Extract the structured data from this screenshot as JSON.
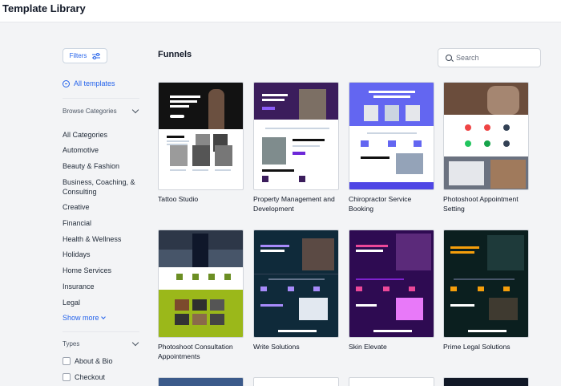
{
  "app": {
    "title": "Template Library"
  },
  "sidebar": {
    "filters_label": "Filters",
    "all_templates_label": "All templates",
    "browse_categories_label": "Browse Categories",
    "categories": [
      "All Categories",
      "Automotive",
      "Beauty & Fashion",
      "Business, Coaching, & Consulting",
      "Creative",
      "Financial",
      "Health & Wellness",
      "Holidays",
      "Home Services",
      "Insurance",
      "Legal"
    ],
    "show_more_label": "Show more",
    "types_label": "Types",
    "types": [
      "About & Bio",
      "Checkout"
    ]
  },
  "main": {
    "title": "Funnels",
    "search": {
      "placeholder": "Search"
    },
    "templates": [
      {
        "name": "Tattoo Studio",
        "color": "#111111"
      },
      {
        "name": "Property Management and Development",
        "color": "#3b1d5c"
      },
      {
        "name": "Chiropractor Service Booking",
        "color": "#6366f1"
      },
      {
        "name": "Photoshoot Appointment Setting",
        "color": "#1f2937"
      },
      {
        "name": "Photoshoot Consultation Appointments",
        "color": "#9bb81a"
      },
      {
        "name": "Write Solutions",
        "color": "#0f2a3a"
      },
      {
        "name": "Skin Elevate",
        "color": "#2e0b52"
      },
      {
        "name": "Prime Legal Solutions",
        "color": "#0b1f1f"
      }
    ]
  }
}
